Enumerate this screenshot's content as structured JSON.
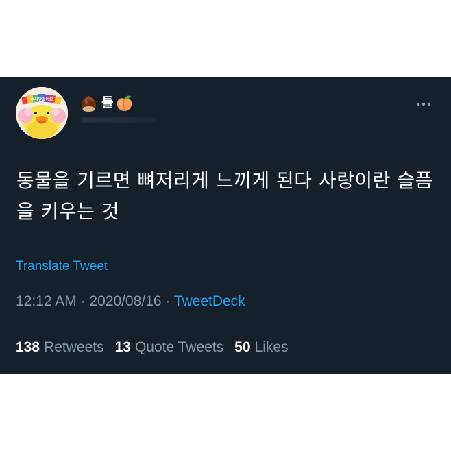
{
  "tweet": {
    "author": {
      "display_name": "튤",
      "name_emoji_left": "chestnut-icon",
      "name_emoji_right": "peach-icon",
      "avatar": "yellow-duck-avatar",
      "avatar_headband_text": "수지맞았어요"
    },
    "more_icon": "more-horizontal-icon",
    "text": "동물을 기르면 뼈저리게 느끼게 된다 사랑이란 슬픔을 키우는 것",
    "translate_label": "Translate Tweet",
    "time": "12:12 AM",
    "date": "2020/08/16",
    "separator": "·",
    "source": "TweetDeck",
    "stats": {
      "retweets": {
        "count": "138",
        "label": "Retweets"
      },
      "quote_tweets": {
        "count": "13",
        "label": "Quote Tweets"
      },
      "likes": {
        "count": "50",
        "label": "Likes"
      }
    }
  },
  "colors": {
    "card_background": "#15202b",
    "text_primary": "#ffffff",
    "text_secondary": "#8899a6",
    "link_blue": "#1da1f2",
    "divider": "#38444d",
    "page_background": "#ffffff"
  }
}
